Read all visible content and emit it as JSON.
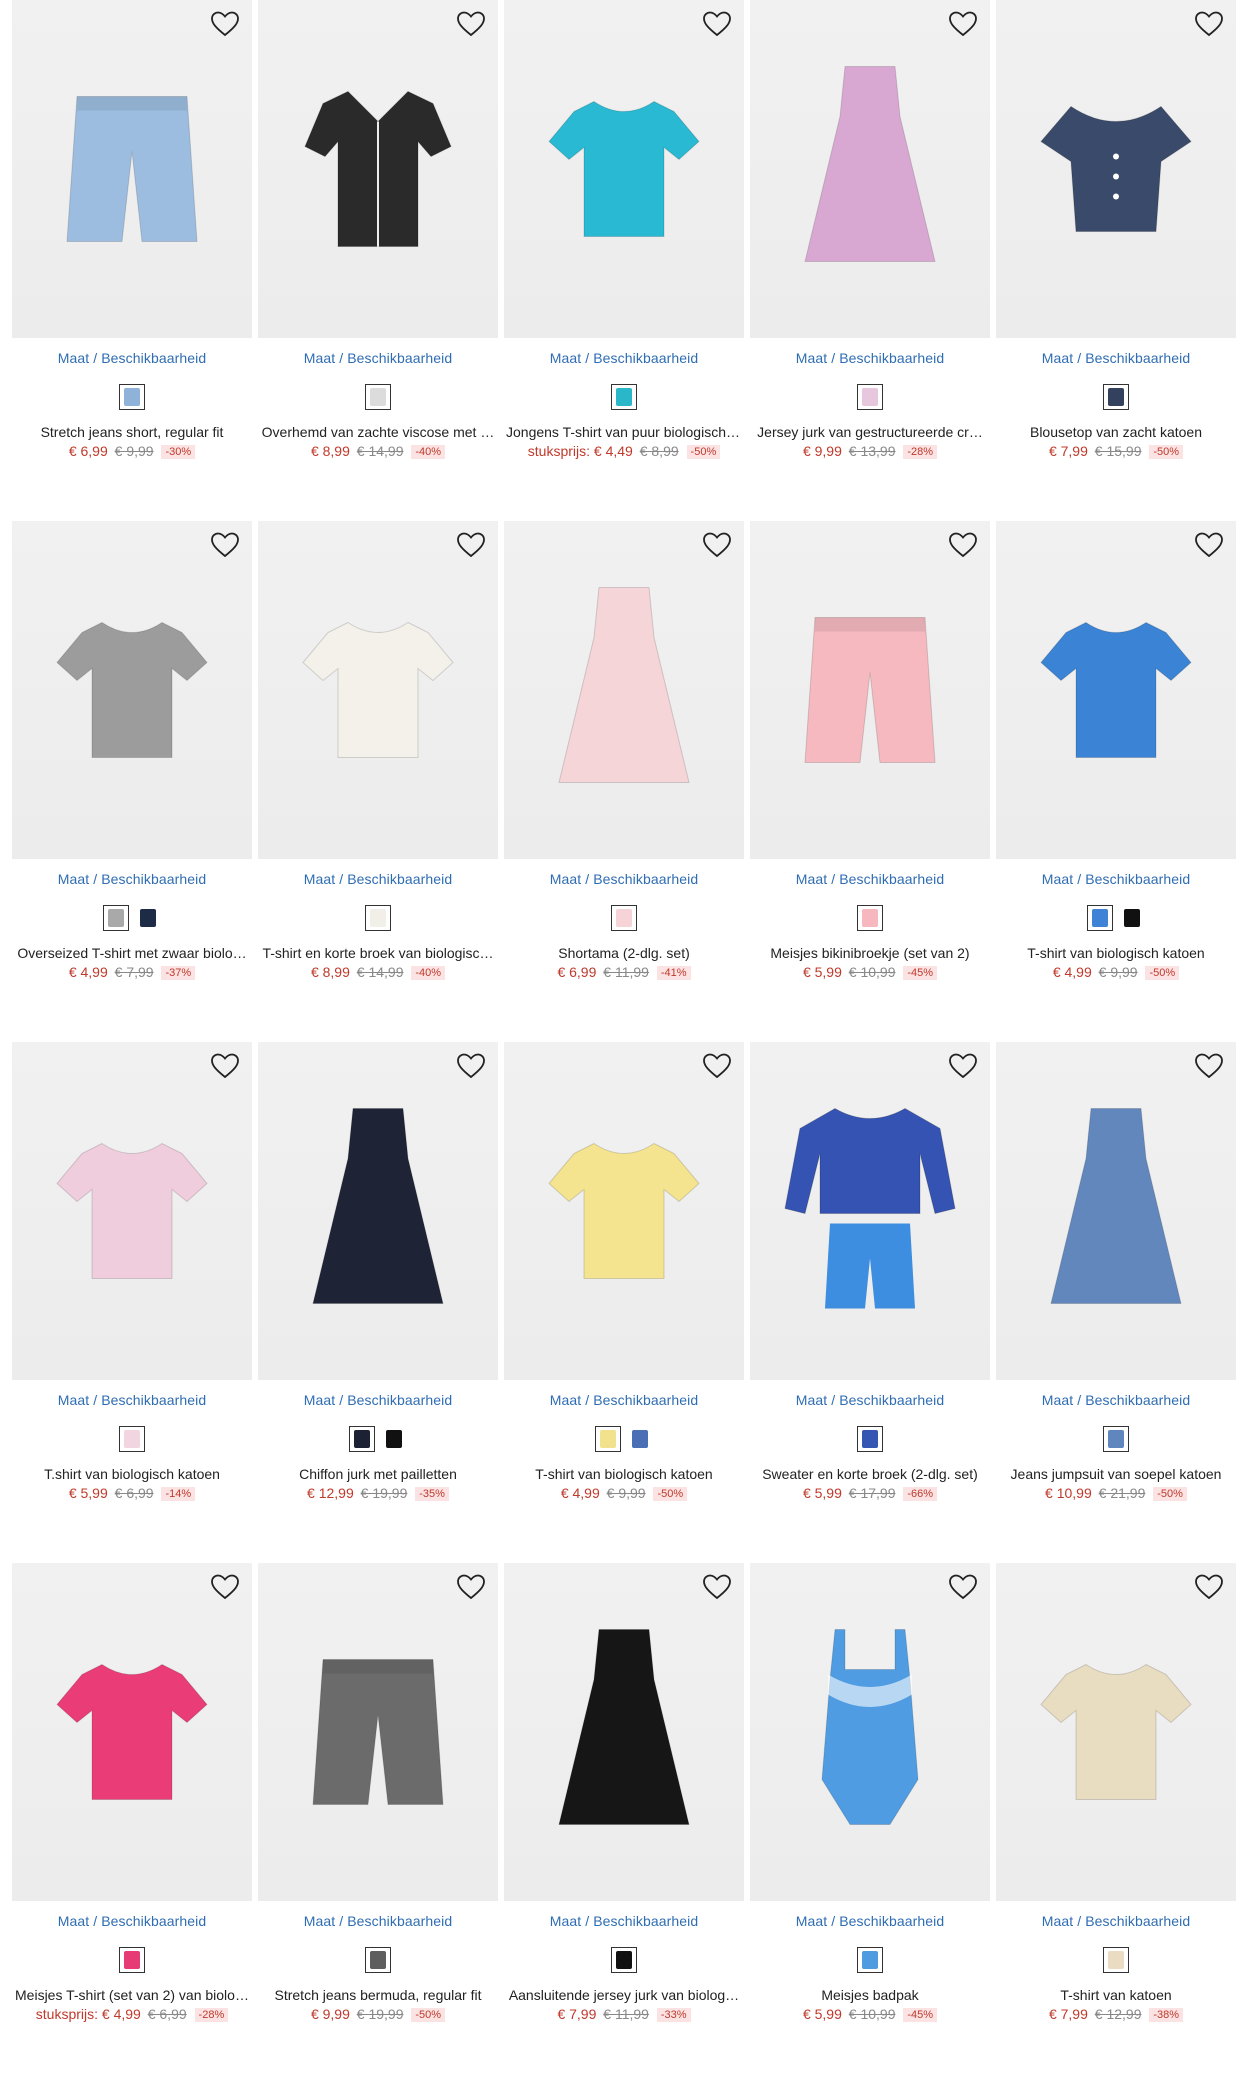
{
  "size_link_label": "Maat / Beschikbaarheid",
  "wishlist_icon": "heart-outline-icon",
  "products": [
    {
      "title": "Stretch jeans short, regular fit",
      "unit_label": "",
      "price": "€ 6,99",
      "old_price": "€ 9,99",
      "discount": "-30%",
      "swatches": [
        "#8fb2d8"
      ],
      "garment": "#9dbde0",
      "shape": "shorts"
    },
    {
      "title": "Overhemd van zachte viscose met …",
      "unit_label": "",
      "price": "€ 8,99",
      "old_price": "€ 14,99",
      "discount": "-40%",
      "swatches": [
        "#dcdcdc"
      ],
      "garment": "#2a2a2a",
      "shape": "shirt"
    },
    {
      "title": "Jongens T-shirt van puur biologisch …",
      "unit_label": "stuksprijs:",
      "price": "€ 4,49",
      "old_price": "€ 8,99",
      "discount": "-50%",
      "swatches": [
        "#2ab7c9"
      ],
      "garment": "#29b9d3",
      "shape": "tshirt"
    },
    {
      "title": "Jersey jurk van gestructureerde cr…",
      "unit_label": "",
      "price": "€ 9,99",
      "old_price": "€ 13,99",
      "discount": "-28%",
      "swatches": [
        "#e6c7dd"
      ],
      "garment": "#d9a8d2",
      "shape": "dress"
    },
    {
      "title": "Blousetop van zacht katoen",
      "unit_label": "",
      "price": "€ 7,99",
      "old_price": "€ 15,99",
      "discount": "-50%",
      "swatches": [
        "#33415e"
      ],
      "garment": "#3a4a6b",
      "shape": "blouse"
    },
    {
      "title": "Overseized T-shirt met zwaar biolo…",
      "unit_label": "",
      "price": "€ 4,99",
      "old_price": "€ 7,99",
      "discount": "-37%",
      "swatches": [
        "#a9a9a9",
        "#1e2b47"
      ],
      "garment": "#9c9c9c",
      "shape": "tshirt"
    },
    {
      "title": "T-shirt en korte broek van biologisc…",
      "unit_label": "",
      "price": "€ 8,99",
      "old_price": "€ 14,99",
      "discount": "-40%",
      "swatches": [
        "#f2efe8"
      ],
      "garment": "#f3f1ea",
      "shape": "tshirt"
    },
    {
      "title": "Shortama (2-dlg. set)",
      "unit_label": "",
      "price": "€ 6,99",
      "old_price": "€ 11,99",
      "discount": "-41%",
      "swatches": [
        "#f6d3d6"
      ],
      "garment": "#f5d5d8",
      "shape": "dress"
    },
    {
      "title": "Meisjes bikinibroekje (set van 2)",
      "unit_label": "",
      "price": "€ 5,99",
      "old_price": "€ 10,99",
      "discount": "-45%",
      "swatches": [
        "#f7b7bf"
      ],
      "garment": "#f6b9c0",
      "shape": "shorts"
    },
    {
      "title": "T-shirt van biologisch katoen",
      "unit_label": "",
      "price": "€ 4,99",
      "old_price": "€ 9,99",
      "discount": "-50%",
      "swatches": [
        "#3f83d6",
        "#111111"
      ],
      "garment": "#3b83d4",
      "shape": "tshirt"
    },
    {
      "title": "T.shirt van biologisch katoen",
      "unit_label": "",
      "price": "€ 5,99",
      "old_price": "€ 6,99",
      "discount": "-14%",
      "swatches": [
        "#f1d6e2"
      ],
      "garment": "#f0cddd",
      "shape": "tshirt"
    },
    {
      "title": "Chiffon jurk met pailletten",
      "unit_label": "",
      "price": "€ 12,99",
      "old_price": "€ 19,99",
      "discount": "-35%",
      "swatches": [
        "#1c2233",
        "#111111"
      ],
      "garment": "#1e2436",
      "shape": "dress"
    },
    {
      "title": "T-shirt van biologisch katoen",
      "unit_label": "",
      "price": "€ 4,99",
      "old_price": "€ 9,99",
      "discount": "-50%",
      "swatches": [
        "#f3e28d",
        "#4a6fb5"
      ],
      "garment": "#f4e48f",
      "shape": "tshirt"
    },
    {
      "title": "Sweater en korte broek (2-dlg. set)",
      "unit_label": "",
      "price": "€ 5,99",
      "old_price": "€ 17,99",
      "discount": "-66%",
      "swatches": [
        "#3656b4"
      ],
      "garment": "#3553b3",
      "shape": "sweater"
    },
    {
      "title": "Jeans jumpsuit van soepel katoen",
      "unit_label": "",
      "price": "€ 10,99",
      "old_price": "€ 21,99",
      "discount": "-50%",
      "swatches": [
        "#5f86bd"
      ],
      "garment": "#6287bd",
      "shape": "dress"
    },
    {
      "title": "Meisjes T-shirt (set van 2) van biolo…",
      "unit_label": "stuksprijs:",
      "price": "€ 4,99",
      "old_price": "€ 6,99",
      "discount": "-28%",
      "swatches": [
        "#e63b74"
      ],
      "garment": "#ea3c77",
      "shape": "tshirt"
    },
    {
      "title": "Stretch jeans bermuda, regular fit",
      "unit_label": "",
      "price": "€ 9,99",
      "old_price": "€ 19,99",
      "discount": "-50%",
      "swatches": [
        "#5e5e5e"
      ],
      "garment": "#6b6b6b",
      "shape": "shorts"
    },
    {
      "title": "Aansluitende jersey jurk van biolog…",
      "unit_label": "",
      "price": "€ 7,99",
      "old_price": "€ 11,99",
      "discount": "-33%",
      "swatches": [
        "#111111"
      ],
      "garment": "#161616",
      "shape": "dress"
    },
    {
      "title": "Meisjes badpak",
      "unit_label": "",
      "price": "€ 5,99",
      "old_price": "€ 10,99",
      "discount": "-45%",
      "swatches": [
        "#4e9be0"
      ],
      "garment": "#4f9ce2",
      "shape": "swimsuit"
    },
    {
      "title": "T-shirt van katoen",
      "unit_label": "",
      "price": "€ 7,99",
      "old_price": "€ 12,99",
      "discount": "-38%",
      "swatches": [
        "#e9dcc0"
      ],
      "garment": "#e8dcc1",
      "shape": "tshirt"
    }
  ]
}
